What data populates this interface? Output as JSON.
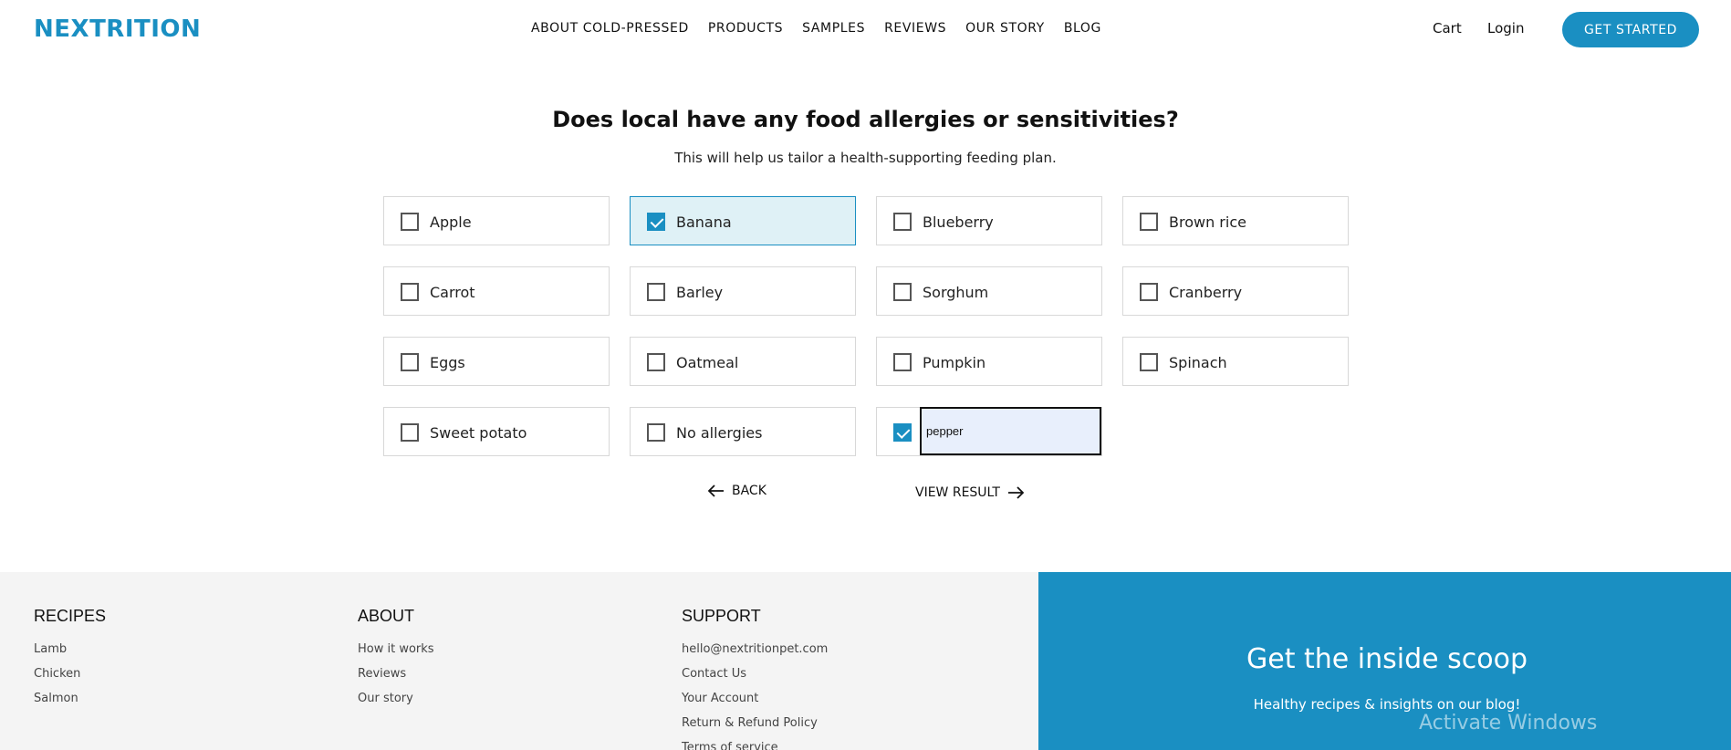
{
  "header": {
    "logo": "NEXTRITION",
    "nav": [
      "ABOUT COLD-PRESSED",
      "PRODUCTS",
      "SAMPLES",
      "REVIEWS",
      "OUR STORY",
      "BLOG"
    ],
    "cart": "Cart",
    "login": "Login",
    "cta": "GET STARTED"
  },
  "question": {
    "title": "Does local have any food allergies or sensitivities?",
    "subtitle": "This will help us tailor a health-supporting feeding plan."
  },
  "options": [
    {
      "label": "Apple",
      "checked": false
    },
    {
      "label": "Banana",
      "checked": true
    },
    {
      "label": "Blueberry",
      "checked": false
    },
    {
      "label": "Brown rice",
      "checked": false
    },
    {
      "label": "Carrot",
      "checked": false
    },
    {
      "label": "Barley",
      "checked": false
    },
    {
      "label": "Sorghum",
      "checked": false
    },
    {
      "label": "Cranberry",
      "checked": false
    },
    {
      "label": "Eggs",
      "checked": false
    },
    {
      "label": "Oatmeal",
      "checked": false
    },
    {
      "label": "Pumpkin",
      "checked": false
    },
    {
      "label": "Spinach",
      "checked": false
    },
    {
      "label": "Sweet potato",
      "checked": false
    },
    {
      "label": "No allergies",
      "checked": false
    }
  ],
  "other": {
    "checked": true,
    "value": "pepper"
  },
  "actions": {
    "back": "BACK",
    "view_result": "VIEW RESULT"
  },
  "footer": {
    "recipes": {
      "title": "RECIPES",
      "links": [
        "Lamb",
        "Chicken",
        "Salmon"
      ]
    },
    "about": {
      "title": "ABOUT",
      "links": [
        "How it works",
        "Reviews",
        "Our story"
      ]
    },
    "support": {
      "title": "SUPPORT",
      "links": [
        "hello@nextritionpet.com",
        "Contact Us",
        "Your Account",
        "Return & Refund Policy",
        "Terms of service"
      ]
    },
    "scoop": {
      "title": "Get the inside scoop",
      "subtitle": "Healthy recipes & insights on our blog!"
    }
  },
  "watermark": "Activate Windows",
  "colors": {
    "brand": "#1a8fc2",
    "checked_bg": "#dff1f6"
  }
}
